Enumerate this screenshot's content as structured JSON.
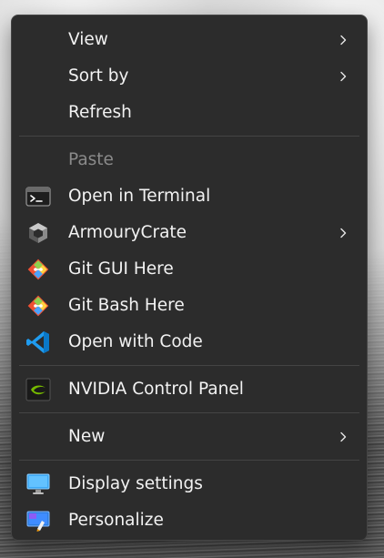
{
  "menu": {
    "items": {
      "view": {
        "label": "View",
        "has_submenu": true
      },
      "sort_by": {
        "label": "Sort by",
        "has_submenu": true
      },
      "refresh": {
        "label": "Refresh"
      },
      "paste": {
        "label": "Paste",
        "disabled": true
      },
      "open_terminal": {
        "label": "Open in Terminal",
        "icon": "terminal-icon"
      },
      "armourycrate": {
        "label": "ArmouryCrate",
        "icon": "armourycrate-icon",
        "has_submenu": true
      },
      "git_gui": {
        "label": "Git GUI Here",
        "icon": "git-gui-icon"
      },
      "git_bash": {
        "label": "Git Bash Here",
        "icon": "git-bash-icon"
      },
      "open_code": {
        "label": "Open with Code",
        "icon": "vscode-icon"
      },
      "nvidia": {
        "label": "NVIDIA Control Panel",
        "icon": "nvidia-icon"
      },
      "new": {
        "label": "New",
        "has_submenu": true
      },
      "display_settings": {
        "label": "Display settings",
        "icon": "display-settings-icon"
      },
      "personalize": {
        "label": "Personalize",
        "icon": "personalize-icon"
      }
    }
  },
  "colors": {
    "menu_bg": "#2c2c2c",
    "text": "#f2f2f2",
    "disabled_text": "#8a8a8a",
    "vscode_blue": "#1f9cf0",
    "git_orange": "#f05033",
    "nvidia_green": "#76b900"
  }
}
